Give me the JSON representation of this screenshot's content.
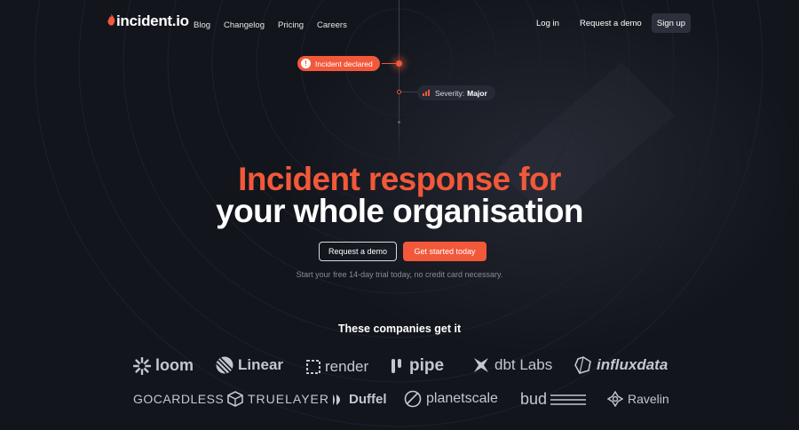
{
  "brand": {
    "name": "incident.io",
    "accent": "#f2583a",
    "background": "#12151c"
  },
  "nav": {
    "links": [
      "Blog",
      "Changelog",
      "Pricing",
      "Careers"
    ],
    "login": "Log in",
    "request_demo": "Request a demo",
    "signup": "Sign up"
  },
  "timeline": {
    "declared_label": "Incident declared",
    "severity_label": "Severity:",
    "severity_value": "Major"
  },
  "hero": {
    "title_line1": "Incident response for",
    "title_line2": "your whole organisation",
    "demo_button": "Request a demo",
    "start_button": "Get started today",
    "subtext": "Start your free 14-day trial today, no credit card necessary."
  },
  "companies": {
    "title": "These companies get it",
    "row1": [
      "loom",
      "Linear",
      "render",
      "pipe",
      "dbt Labs",
      "influxdata"
    ],
    "row2": [
      "GOCARDLESS",
      "TRUELAYER",
      "Duffel",
      "planetscale",
      "bud",
      "Ravelin"
    ]
  }
}
